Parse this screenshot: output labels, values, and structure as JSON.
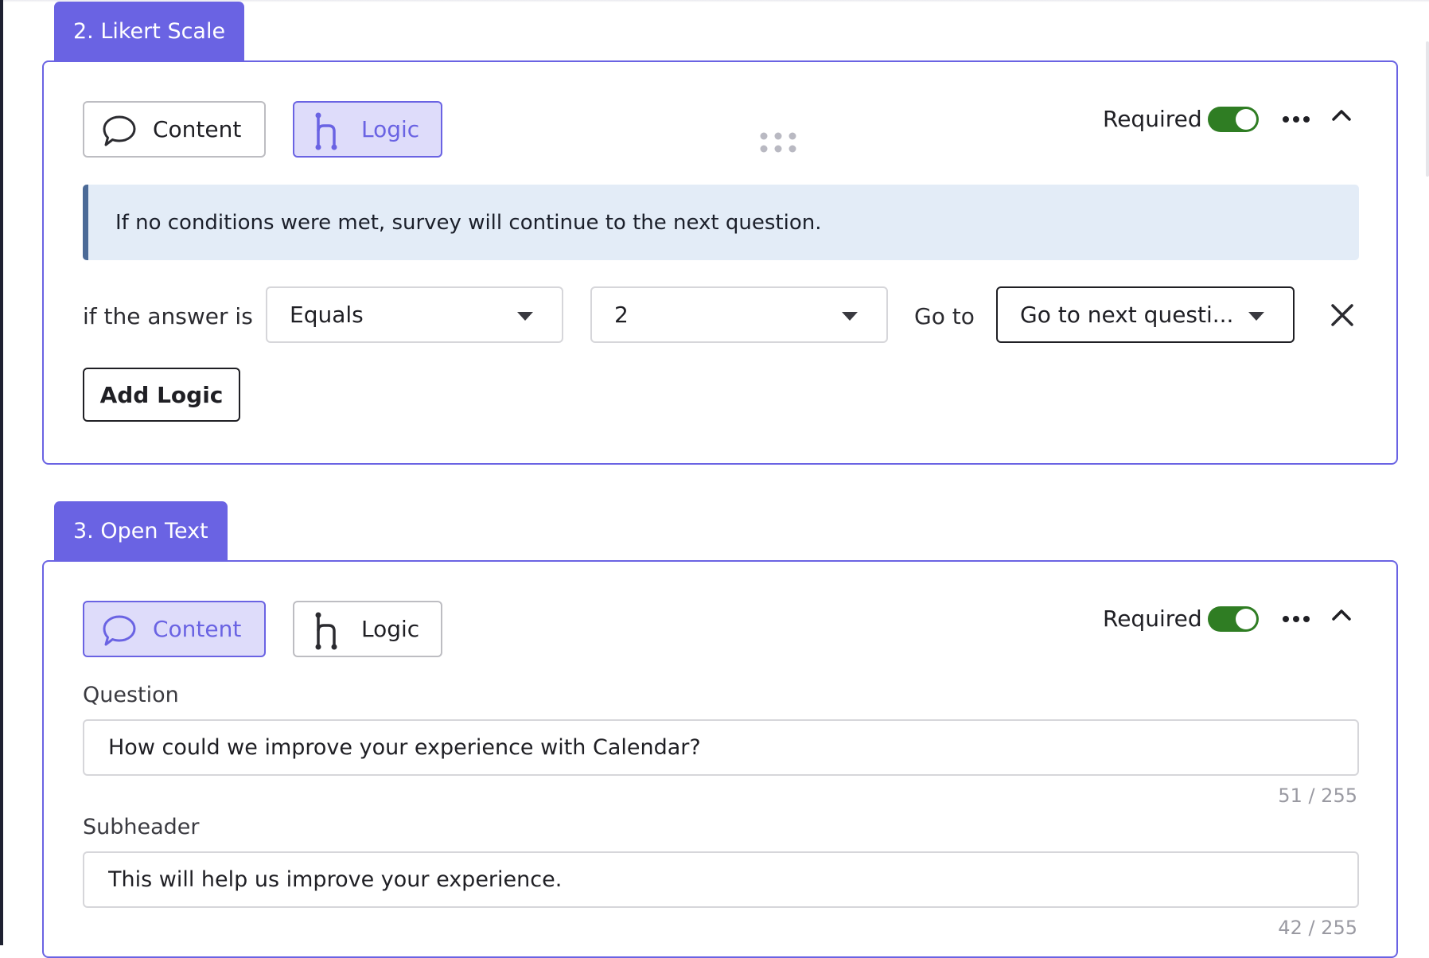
{
  "questions": [
    {
      "tab_label": "2. Likert Scale",
      "tabs": {
        "content_label": "Content",
        "logic_label": "Logic",
        "active": "logic"
      },
      "required_label": "Required",
      "required_on": true,
      "logic": {
        "banner_text": "If no conditions were met, survey will continue to the next question.",
        "condition_label": "if the answer is",
        "operator_value": "Equals",
        "answer_value": "2",
        "goto_label": "Go to",
        "goto_value": "Go to next questi...",
        "add_logic_label": "Add Logic"
      }
    },
    {
      "tab_label": "3. Open Text",
      "tabs": {
        "content_label": "Content",
        "logic_label": "Logic",
        "active": "content"
      },
      "required_label": "Required",
      "required_on": true,
      "content": {
        "question_label": "Question",
        "question_value": "How could we improve your experience with Calendar?",
        "question_counter": "51 / 255",
        "subheader_label": "Subheader",
        "subheader_value": "This will help us improve your experience.",
        "subheader_counter": "42 / 255"
      }
    }
  ],
  "colors": {
    "accent": "#6a63e3",
    "accent_light": "#dedcfa",
    "toggle_on": "#2f7d23",
    "banner_bg": "#e3ecf7",
    "banner_border": "#4b6a97"
  }
}
